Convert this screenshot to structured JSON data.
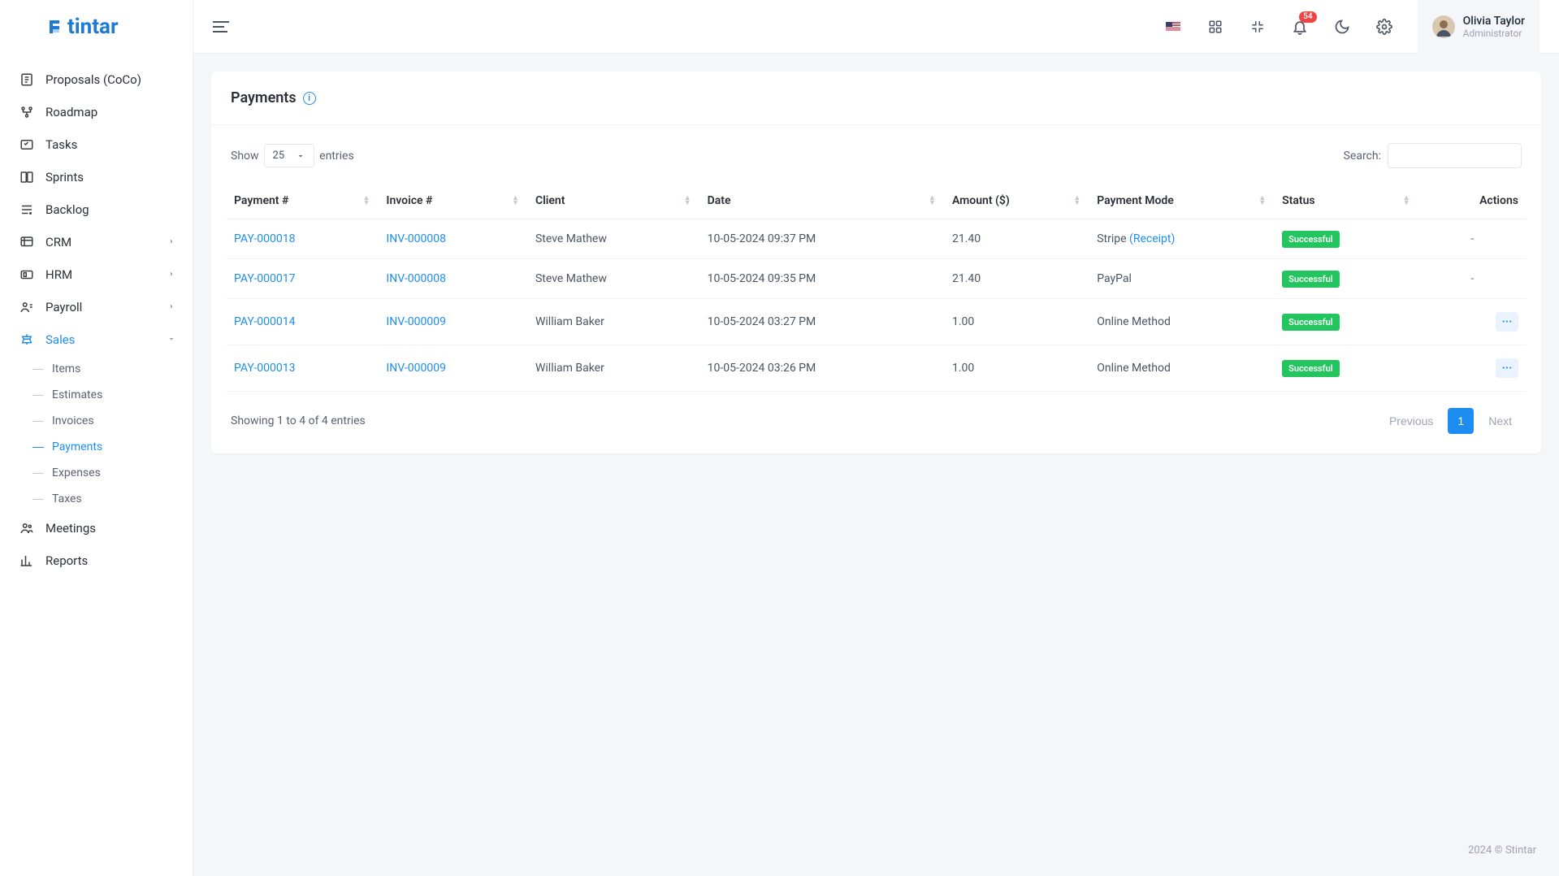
{
  "brand": "tintar",
  "user": {
    "name": "Olivia Taylor",
    "role": "Administrator"
  },
  "notifications": "54",
  "sidebar": {
    "items": [
      {
        "label": "Proposals (CoCo)"
      },
      {
        "label": "Roadmap"
      },
      {
        "label": "Tasks"
      },
      {
        "label": "Sprints"
      },
      {
        "label": "Backlog"
      },
      {
        "label": "CRM",
        "expandable": true
      },
      {
        "label": "HRM",
        "expandable": true
      },
      {
        "label": "Payroll",
        "expandable": true
      },
      {
        "label": "Sales",
        "expandable": true,
        "active": true
      },
      {
        "label": "Meetings"
      },
      {
        "label": "Reports"
      }
    ],
    "salesSub": [
      {
        "label": "Items"
      },
      {
        "label": "Estimates"
      },
      {
        "label": "Invoices"
      },
      {
        "label": "Payments",
        "active": true
      },
      {
        "label": "Expenses"
      },
      {
        "label": "Taxes"
      }
    ]
  },
  "page": {
    "title": "Payments",
    "showLabel": "Show",
    "entriesLabel": "entries",
    "perPage": "25",
    "searchLabel": "Search:",
    "columns": [
      "Payment #",
      "Invoice #",
      "Client",
      "Date",
      "Amount ($)",
      "Payment Mode",
      "Status",
      "Actions"
    ],
    "rows": [
      {
        "payment": "PAY-000018",
        "invoice": "INV-000008",
        "client": "Steve Mathew",
        "date": "10-05-2024 09:37 PM",
        "amount": "21.40",
        "mode": "Stripe",
        "receipt": "(Receipt)",
        "status": "Successful",
        "action": "dash"
      },
      {
        "payment": "PAY-000017",
        "invoice": "INV-000008",
        "client": "Steve Mathew",
        "date": "10-05-2024 09:35 PM",
        "amount": "21.40",
        "mode": "PayPal",
        "status": "Successful",
        "action": "dash"
      },
      {
        "payment": "PAY-000014",
        "invoice": "INV-000009",
        "client": "William Baker",
        "date": "10-05-2024 03:27 PM",
        "amount": "1.00",
        "mode": "Online Method",
        "status": "Successful",
        "action": "menu"
      },
      {
        "payment": "PAY-000013",
        "invoice": "INV-000009",
        "client": "William Baker",
        "date": "10-05-2024 03:26 PM",
        "amount": "1.00",
        "mode": "Online Method",
        "status": "Successful",
        "action": "menu"
      }
    ],
    "entriesInfo": "Showing 1 to 4 of 4 entries",
    "pager": {
      "prev": "Previous",
      "pages": [
        "1"
      ],
      "next": "Next",
      "active": "1"
    }
  },
  "footer": "2024 © Stintar"
}
